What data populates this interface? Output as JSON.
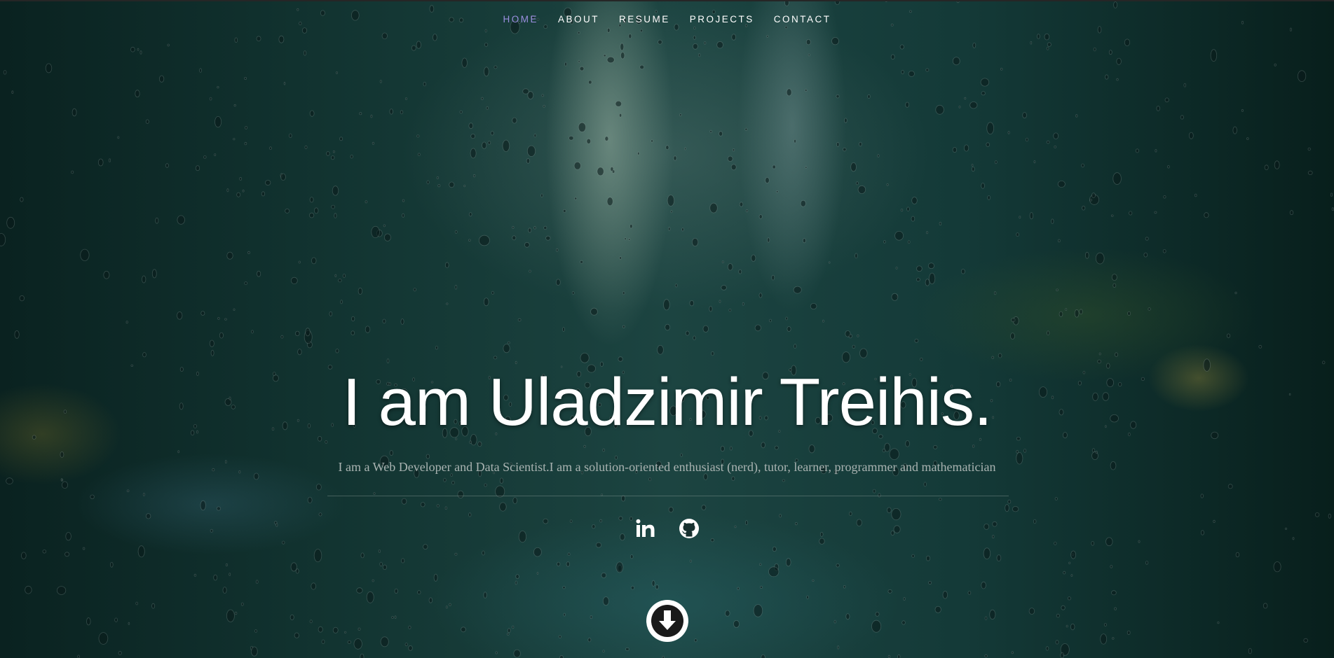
{
  "nav": {
    "items": [
      {
        "label": "Home",
        "active": true
      },
      {
        "label": "About",
        "active": false
      },
      {
        "label": "Resume",
        "active": false
      },
      {
        "label": "Projects",
        "active": false
      },
      {
        "label": "Contact",
        "active": false
      }
    ]
  },
  "hero": {
    "title": "I am Uladzimir Treihis.",
    "subtitle": "I am a Web Developer and Data Scientist.I am a solution-oriented enthusiast (nerd), tutor, learner, programmer and mathematician"
  },
  "social": {
    "icons": [
      "linkedin-icon",
      "github-icon"
    ]
  },
  "scroll": {
    "icon": "arrow-down-circle-icon"
  },
  "colors": {
    "nav_active": "#9b8fe0",
    "text": "#ffffff",
    "subtitle": "#a9b3b1"
  }
}
